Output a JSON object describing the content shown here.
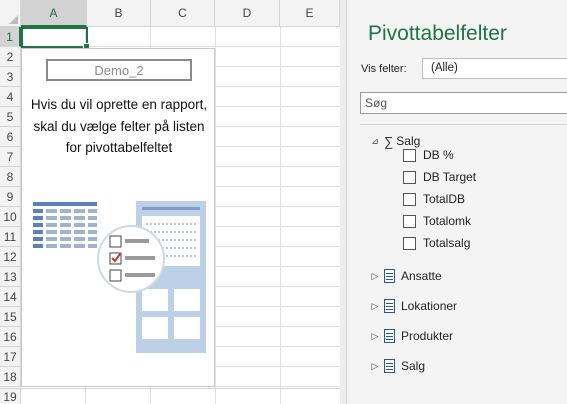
{
  "sheet": {
    "columns": [
      "A",
      "B",
      "C",
      "D",
      "E"
    ],
    "rows": [
      "1",
      "2",
      "3",
      "4",
      "5",
      "6",
      "7",
      "8",
      "9",
      "10",
      "11",
      "12",
      "13",
      "14",
      "15",
      "16",
      "17",
      "18",
      "19"
    ]
  },
  "pivot_placeholder": {
    "name": "Demo_2",
    "message": "Hvis du vil oprette en rapport, skal du vælge felter på listen for pivottabelfeltet"
  },
  "pane": {
    "title": "Pivottabelfelter",
    "vis_label": "Vis felter:",
    "vis_value": "(Alle)",
    "search_placeholder": "Søg",
    "measure_group": {
      "label": "Salg",
      "fields": [
        "DB %",
        "DB Target",
        "TotalDB",
        "Totalomk",
        "Totalsalg"
      ]
    },
    "tables": [
      "Ansatte",
      "Lokationer",
      "Produkter",
      "Salg"
    ]
  },
  "colors": {
    "accent": "#217346",
    "table_icon": "#2b579a",
    "illustration": "#bcd0e6"
  },
  "icons": {
    "sigma": "∑",
    "expanded": "⊿",
    "collapsed": "▷"
  }
}
